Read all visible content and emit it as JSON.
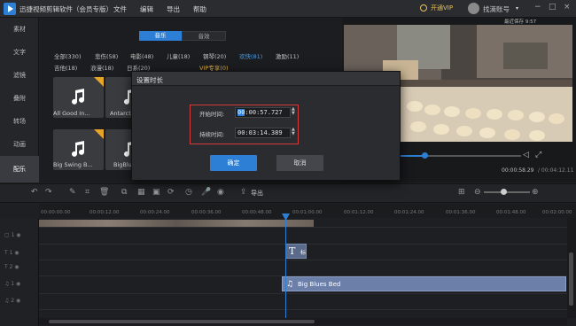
{
  "titlebar": {
    "app_title": "迅捷视频剪辑软件（会员专版）",
    "menu": [
      "文件",
      "编辑",
      "导出",
      "帮助"
    ],
    "vip_label": "开通VIP",
    "username": "找滴账号"
  },
  "window_controls": {
    "minimize": "−",
    "maximize": "□",
    "close": "×"
  },
  "sidebar": {
    "items": [
      {
        "label": "素材"
      },
      {
        "label": "文字"
      },
      {
        "label": "滤镜"
      },
      {
        "label": "叠附"
      },
      {
        "label": "转场"
      },
      {
        "label": "动画"
      },
      {
        "label": "配乐"
      }
    ],
    "active_index": 6
  },
  "library": {
    "tabs": [
      "音乐",
      "音效"
    ],
    "active_tab": "音乐",
    "categories_row1": [
      "全部(330)",
      "悲伤(58)",
      "电影(48)",
      "儿童(18)",
      "钢琴(20)",
      "欢快(81)",
      "激励(11)"
    ],
    "categories_row2": [
      "吉他(18)",
      "浪漫(18)",
      "日系(20)",
      "VIP专享(0)"
    ],
    "selected_category": "欢快(81)",
    "vip_category": "VIP专享(0)",
    "tiles": [
      {
        "name": "All Good In..."
      },
      {
        "name": "Antarctic"
      },
      {
        "name": "Big Swing B..."
      },
      {
        "name": "BigBlues"
      }
    ]
  },
  "preview": {
    "last_saved": "最近保存 9:57",
    "current_time": "00:00:58.29",
    "total_time": "/ 00:04:12.11",
    "progress": 0.46
  },
  "toolbar": {
    "export_label": "导出",
    "zoom_level": 0.37
  },
  "timeline": {
    "ruler_ticks": [
      "00:00:00.00",
      "00:00:12.00",
      "00:00:24.00",
      "00:00:36.00",
      "00:00:48.00",
      "00:01:00.00",
      "00:01:12.00",
      "00:01:24.00",
      "00:01:36.00",
      "00:01:48.00",
      "00:02:00.00"
    ],
    "text_clip_label": "标",
    "audio_clip_label": "Big Blues Bed"
  },
  "dialog": {
    "title": "设置时长",
    "start_label": "开始时间:",
    "start_hours": "00",
    "start_rest": ":00:57.727",
    "duration_label": "持续时间:",
    "duration_value": "00:03:14.389",
    "ok_label": "确定",
    "cancel_label": "取消"
  },
  "colors": {
    "accent": "#2d7fd6",
    "vip": "#e6c25a",
    "highlight_box": "#d63a3a",
    "audio_clip": "#6b7fa8"
  }
}
